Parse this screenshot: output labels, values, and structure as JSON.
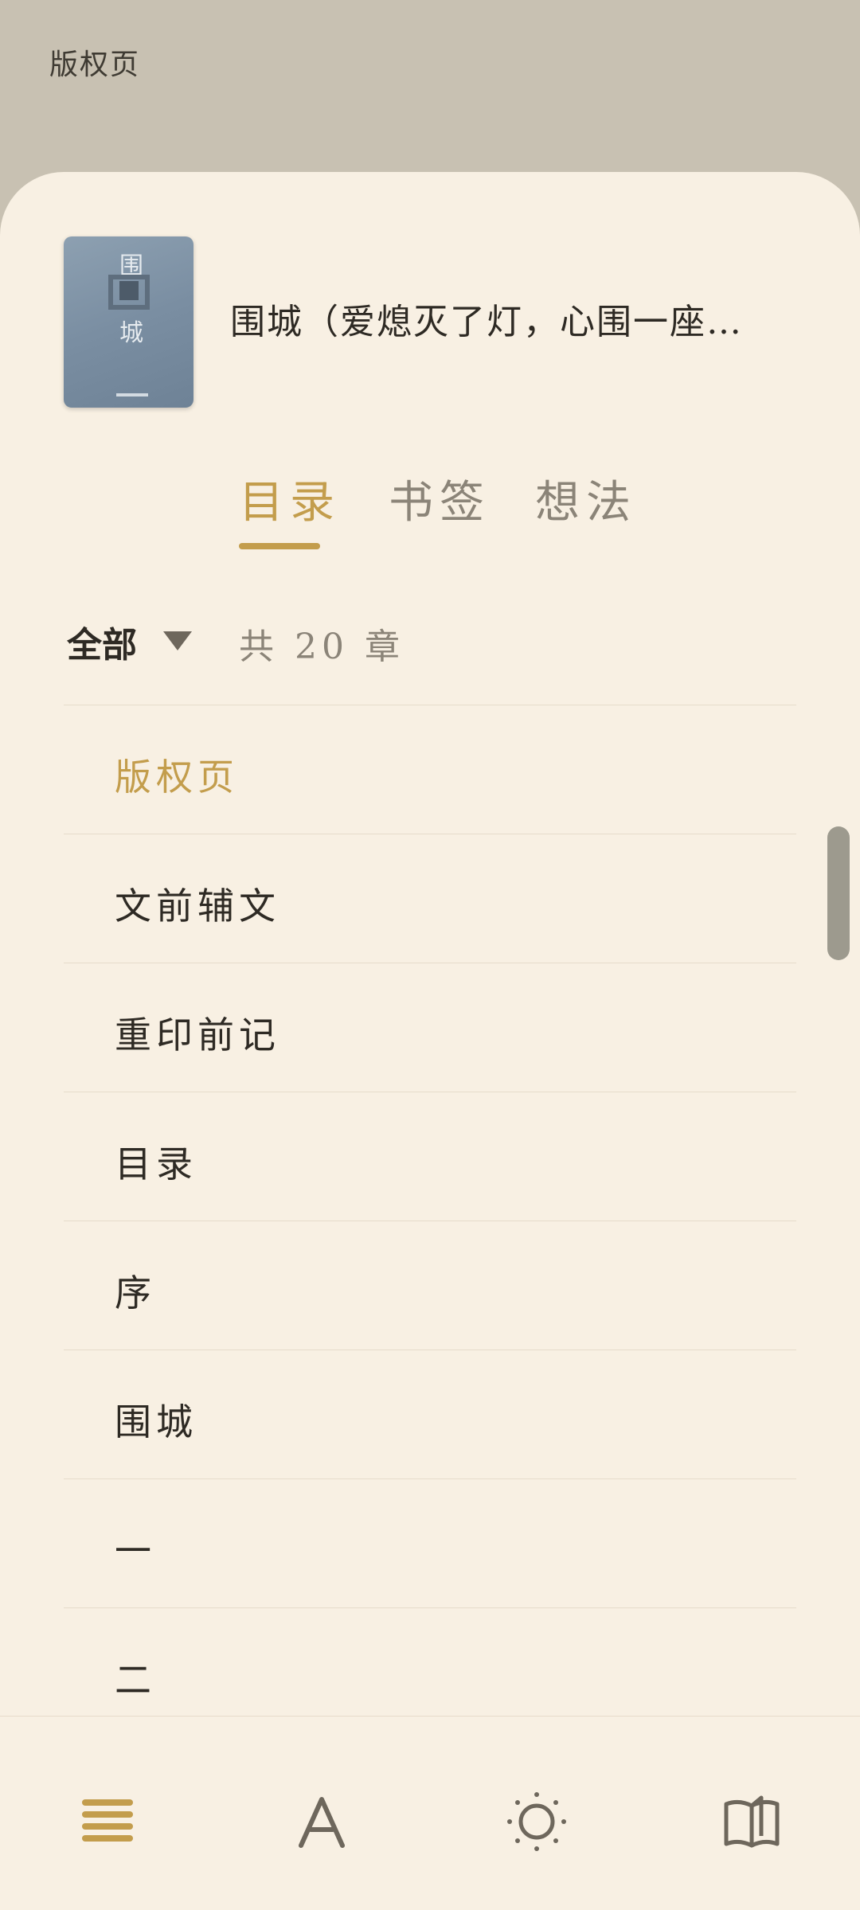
{
  "header": {
    "title": "版权页"
  },
  "book": {
    "title": "围城（爱熄灭了灯，心围一座…",
    "cover": {
      "char_top": "围",
      "char_bottom": "城"
    }
  },
  "tabs": [
    {
      "label": "目录",
      "active": true
    },
    {
      "label": "书签",
      "active": false
    },
    {
      "label": "想法",
      "active": false
    }
  ],
  "filter": {
    "selected": "全部",
    "count_text": "共 20 章"
  },
  "toc": {
    "items": [
      {
        "label": "版权页",
        "active": true
      },
      {
        "label": "文前辅文"
      },
      {
        "label": "重印前记"
      },
      {
        "label": "目录"
      },
      {
        "label": "序"
      },
      {
        "label": "围城"
      },
      {
        "label": "一"
      },
      {
        "label": "二"
      }
    ]
  },
  "bottom_bar": {
    "buttons": [
      {
        "icon": "toc-list-icon",
        "active": true
      },
      {
        "icon": "font-icon"
      },
      {
        "icon": "brightness-icon"
      },
      {
        "icon": "book-open-icon"
      }
    ]
  },
  "colors": {
    "accent": "#c39d4c",
    "background": "#f8f0e3",
    "top_bg": "#c8c1b2",
    "text": "#2e2a24",
    "muted": "#8b8478"
  }
}
